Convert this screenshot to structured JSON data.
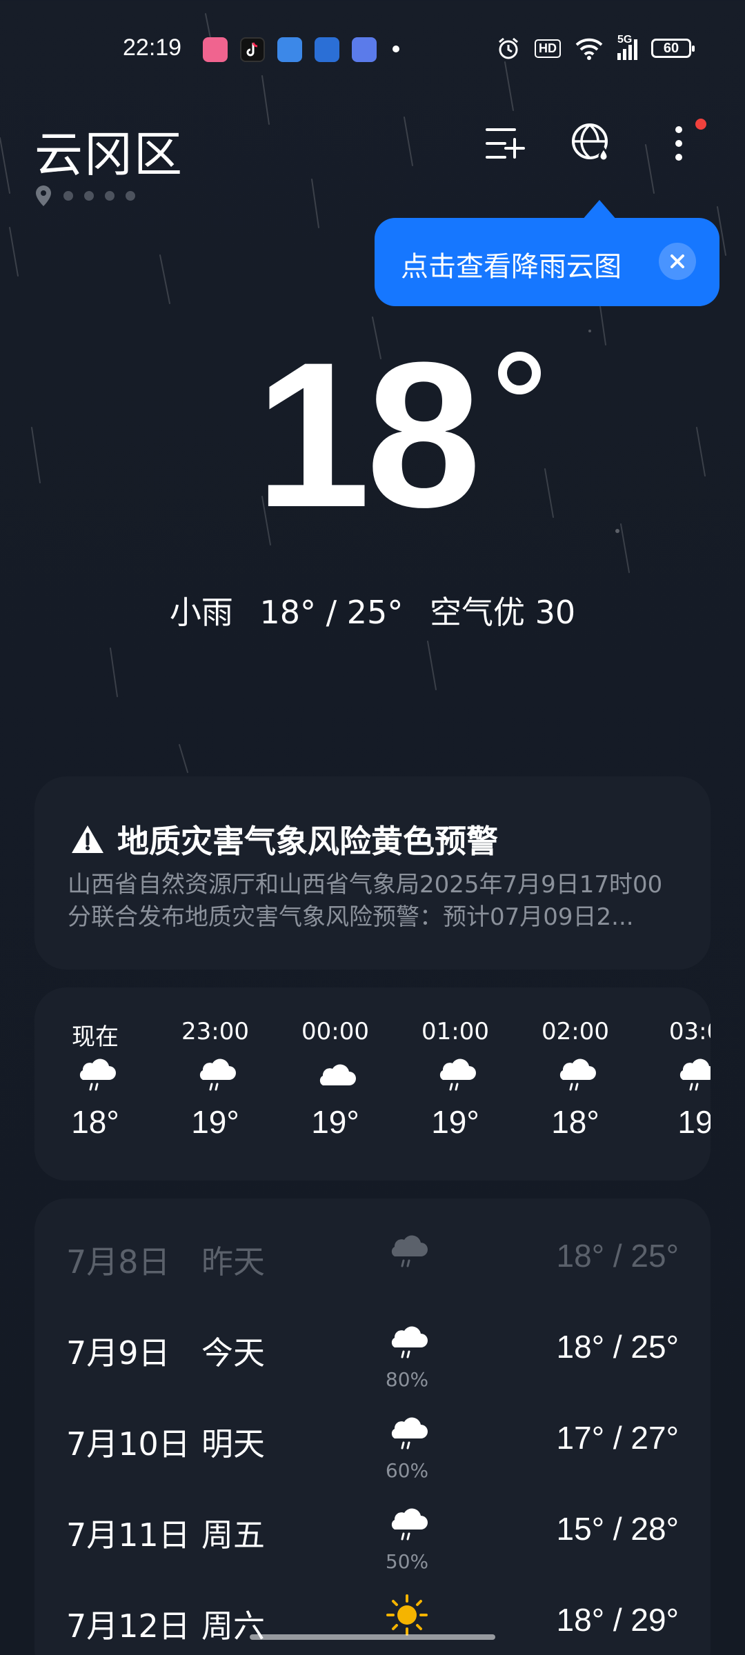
{
  "status_bar": {
    "time": "22:19",
    "network": "5G",
    "hd_label": "HD",
    "battery": "60"
  },
  "header": {
    "city": "云冈区",
    "page_count": 5
  },
  "tooltip": {
    "text": "点击查看降雨云图"
  },
  "current": {
    "temperature": "18",
    "condition": "小雨",
    "range": "18° / 25°",
    "air_quality": "空气优 30"
  },
  "alert": {
    "title": "地质灾害气象风险黄色预警",
    "body": "山西省自然资源厅和山西省气象局2025年7月9日17时00分联合发布地质灾害气象风险预警：预计07月09日2..."
  },
  "hourly": [
    {
      "time": "现在",
      "icon": "rain-cloud-icon",
      "temp": "18°"
    },
    {
      "time": "23:00",
      "icon": "rain-cloud-icon",
      "temp": "19°"
    },
    {
      "time": "00:00",
      "icon": "cloud-icon",
      "temp": "19°"
    },
    {
      "time": "01:00",
      "icon": "rain-cloud-icon",
      "temp": "19°"
    },
    {
      "time": "02:00",
      "icon": "rain-cloud-icon",
      "temp": "18°"
    },
    {
      "time": "03:0",
      "icon": "rain-cloud-icon",
      "temp": "19"
    }
  ],
  "daily": [
    {
      "date": "7月8日",
      "day": "昨天",
      "icon": "rain-cloud-icon",
      "precip": "",
      "range": "18° / 25°"
    },
    {
      "date": "7月9日",
      "day": "今天",
      "icon": "rain-cloud-icon",
      "precip": "80%",
      "range": "18° / 25°"
    },
    {
      "date": "7月10日",
      "day": "明天",
      "icon": "rain-cloud-icon",
      "precip": "60%",
      "range": "17° / 27°"
    },
    {
      "date": "7月11日",
      "day": "周五",
      "icon": "rain-cloud-icon",
      "precip": "50%",
      "range": "15° / 28°"
    },
    {
      "date": "7月12日",
      "day": "周六",
      "icon": "sun-icon",
      "precip": "",
      "range": "18° / 29°"
    }
  ],
  "colors": {
    "background": "#161c27",
    "card": "#1a202b",
    "accent_blue": "#1677ff",
    "badge_red": "#f0413d",
    "sun": "#f5b400"
  }
}
